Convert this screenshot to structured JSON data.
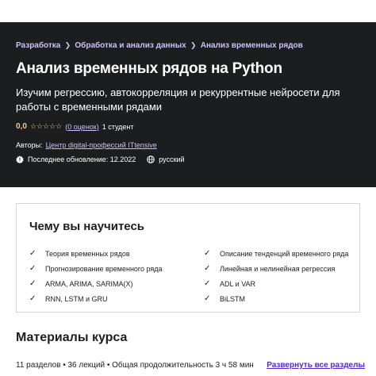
{
  "breadcrumb": {
    "items": [
      {
        "label": "Разработка"
      },
      {
        "label": "Обработка и анализ данных"
      },
      {
        "label": "Анализ временных рядов"
      }
    ]
  },
  "course": {
    "title": "Анализ временных рядов на Python",
    "subtitle": "Изучим регрессию, автокорреляция и рекуррентные нейросети для работы с временными рядами",
    "rating_value": "0,0",
    "stars": "☆☆☆☆☆",
    "ratings_link": "(0 оценок)",
    "students": "1 студент",
    "authors_label": "Авторы:",
    "author": "Центр digital-профессий ITtensive",
    "last_updated": "Последнее обновление: 12.2022",
    "language": "русский"
  },
  "learn": {
    "title": "Чему вы научитесь",
    "left_items": [
      {
        "label": "Теория временных рядов"
      },
      {
        "label": "Прогнозирование временного ряда"
      },
      {
        "label": "ARMA, ARIMA, SARIMA(X)"
      },
      {
        "label": "RNN, LSTM и GRU"
      }
    ],
    "right_items": [
      {
        "label": "Описание тенденций временного ряда"
      },
      {
        "label": "Линейная и нелинейная регрессия"
      },
      {
        "label": "ADL и VAR"
      },
      {
        "label": "BiLSTM"
      }
    ]
  },
  "materials": {
    "title": "Материалы курса",
    "stats": "11 разделов • 36 лекций • Общая продолжительность 3 ч 58 мин",
    "expand_label": "Развернуть все разделы"
  },
  "colors": {
    "hero_bg": "#1c1d1f",
    "link_purple": "#cec0fc",
    "star_yellow": "#f3ca8c",
    "expand_purple": "#5624d0"
  }
}
